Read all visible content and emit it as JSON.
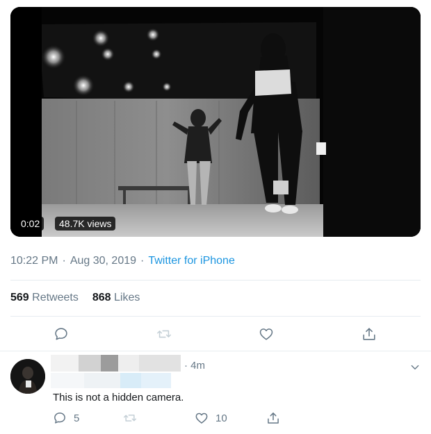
{
  "media": {
    "duration": "0:02",
    "views": "48.7K views"
  },
  "tweet": {
    "time": "10:22 PM",
    "date": "Aug 30, 2019",
    "separator": "·",
    "source": "Twitter for iPhone",
    "retweets_count": "569",
    "retweets_label": "Retweets",
    "likes_count": "868",
    "likes_label": "Likes"
  },
  "actions": {
    "reply_icon": "speech-bubble-icon",
    "retweet_icon": "retweet-arrows-icon",
    "like_icon": "heart-icon",
    "share_icon": "share-upload-icon"
  },
  "reply": {
    "time_sep": "·",
    "time": "4m",
    "text": "This is not a hidden camera.",
    "reply_count": "5",
    "like_count": "10",
    "caret_icon": "chevron-down-icon"
  },
  "colors": {
    "link_blue": "#1b95e0",
    "muted_gray": "#657786",
    "divider": "#e6ecf0",
    "text": "#14171a"
  }
}
